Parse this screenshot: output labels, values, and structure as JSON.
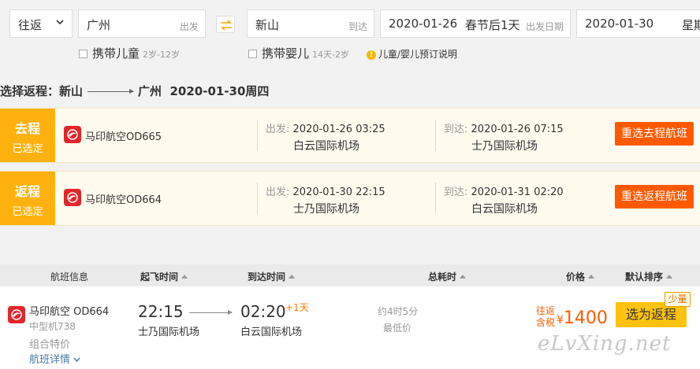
{
  "search": {
    "trip_type": "往返",
    "from_city": "广州",
    "from_hint": "出发",
    "to_city": "新山",
    "to_hint": "到达",
    "depart_date": "2020-01-26",
    "depart_note": "春节后1天",
    "depart_hint": "出发日期",
    "return_date": "2020-01-30",
    "return_week": "星期"
  },
  "options": {
    "child_label": "携带儿童",
    "child_age": "2岁-12岁",
    "infant_label": "携带婴儿",
    "infant_age": "14天-2岁",
    "booking_note": "儿童/婴儿预订说明"
  },
  "heading": {
    "prefix": "选择返程：新山",
    "dest": "广州",
    "date": "2020-01-30周四"
  },
  "outbound": {
    "tag_title": "去程",
    "tag_status": "已选定",
    "airline": "马印航空OD665",
    "depart_label": "出发:",
    "depart_time": "2020-01-26 03:25",
    "depart_airport": "白云国际机场",
    "arrive_label": "到达:",
    "arrive_time": "2020-01-26 07:15",
    "arrive_airport": "士乃国际机场",
    "reselect": "重选去程航班"
  },
  "inbound": {
    "tag_title": "返程",
    "tag_status": "已选定",
    "airline": "马印航空OD664",
    "depart_label": "出发:",
    "depart_time": "2020-01-30 22:15",
    "depart_airport": "士乃国际机场",
    "arrive_label": "到达:",
    "arrive_time": "2020-01-31 02:20",
    "arrive_airport": "白云国际机场",
    "reselect": "重选返程航班"
  },
  "table": {
    "headers": {
      "flight_info": "航班信息",
      "dep_time": "起飞时间",
      "arr_time": "到达时间",
      "duration": "总耗时",
      "price": "价格",
      "default_sort": "默认排序"
    },
    "rows": [
      {
        "airline": "马印航空 OD664",
        "aircraft": "中型机738",
        "fare_type": "组合特价",
        "details": "航班详情",
        "dep_time": "22:15",
        "dep_airport": "士乃国际机场",
        "arr_time": "02:20",
        "next_day": "+1天",
        "arr_airport": "白云国际机场",
        "duration": "约4时5分",
        "lowest": "最低价",
        "price_tag_1": "往返",
        "price_tag_2": "含税",
        "currency": "¥",
        "price": "1400",
        "select": "选为返程",
        "availability": "少量"
      }
    ]
  },
  "watermark": "eLvXing.net",
  "colors": {
    "accent_orange": "#ff5a00",
    "tag_yellow": "#ffb20f",
    "button_yellow": "#ffc20e",
    "airline_red": "#e4262a"
  }
}
